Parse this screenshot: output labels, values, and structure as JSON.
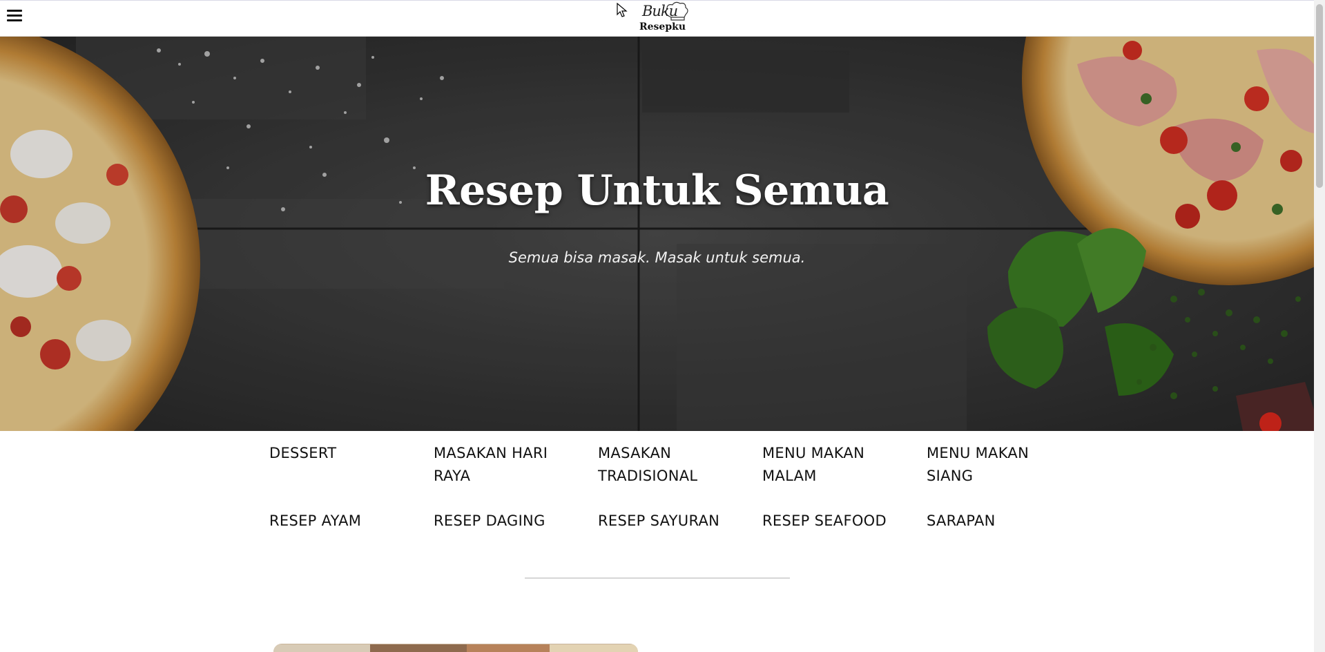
{
  "header": {
    "menu_icon": "hamburger-icon",
    "logo_script": "Buku",
    "logo_text": "Resepku"
  },
  "hero": {
    "title": "Resep Untuk Semua",
    "subtitle": "Semua bisa masak. Masak untuk semua."
  },
  "categories": [
    "DESSERT",
    "MASAKAN HARI RAYA",
    "MASAKAN TRADISIONAL",
    "MENU MAKAN MALAM",
    "MENU MAKAN SIANG",
    "RESEP AYAM",
    "RESEP DAGING",
    "RESEP SAYURAN",
    "RESEP SEAFOOD",
    "SARAPAN"
  ],
  "colors": {
    "hero_overlay": "#3a3a3a",
    "text": "#111111",
    "divider": "#d6d6d6"
  }
}
